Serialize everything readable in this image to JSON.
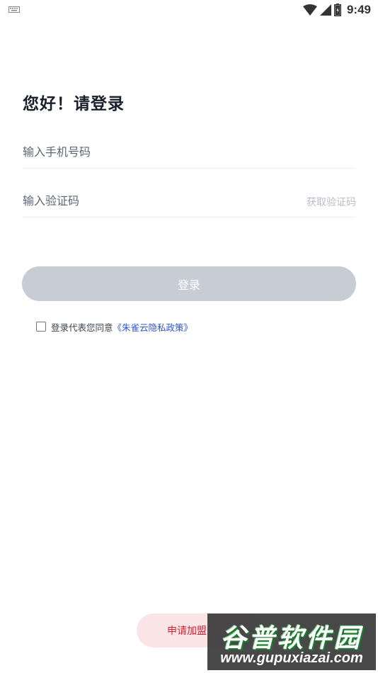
{
  "status_bar": {
    "time": "9:49",
    "icons": [
      "keyboard-icon",
      "wifi-icon",
      "signal-icon",
      "battery-icon"
    ]
  },
  "login": {
    "title": "您好！请登录",
    "phone_placeholder": "输入手机号码",
    "code_placeholder": "输入验证码",
    "get_code_label": "获取验证码",
    "login_button": "登录",
    "agree_text": "登录代表您同意",
    "policy_link": "《朱雀云隐私政策》"
  },
  "footer": {
    "join_button": "申请加盟"
  },
  "watermark": {
    "logo": "谷普软件园",
    "url": "www.gupuxiazai.com"
  },
  "colors": {
    "button_disabled": "#c8ccd4",
    "link": "#2f56c9",
    "join_bg": "#fbe4e6",
    "join_text": "#cf2434"
  }
}
